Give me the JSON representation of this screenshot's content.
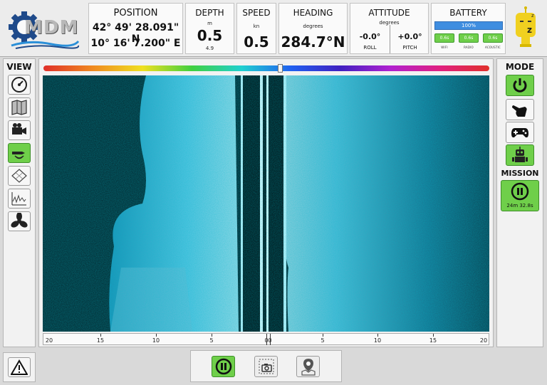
{
  "logo": {
    "text": "MDM"
  },
  "header": {
    "position": {
      "title": "POSITION",
      "lat": "42° 49' 28.091\" N",
      "lon": "10° 16' 7.200\" E"
    },
    "depth": {
      "title": "DEPTH",
      "unit": "m",
      "value": "0.5",
      "sub": "4.9"
    },
    "speed": {
      "title": "SPEED",
      "unit": "kn",
      "value": "0.5"
    },
    "heading": {
      "title": "HEADING",
      "unit": "degrees",
      "value": "284.7°N"
    },
    "attitude": {
      "title": "ATTITUDE",
      "unit": "degrees",
      "roll_value": "-0.0°",
      "roll_label": "ROLL",
      "pitch_value": "+0.0°",
      "pitch_label": "PITCH"
    },
    "battery": {
      "title": "BATTERY",
      "level": "100%",
      "level_fraction": 1.0,
      "links": [
        {
          "value": "0.6s",
          "label": "WIFI"
        },
        {
          "value": "0.6s",
          "label": "RADIO"
        },
        {
          "value": "0.6s",
          "label": "ACOUSTIC"
        }
      ]
    }
  },
  "view": {
    "title": "VIEW",
    "active": "sonar"
  },
  "mode": {
    "title": "MODE"
  },
  "mission": {
    "title": "MISSION",
    "time": "24m 32.8s"
  },
  "colorbar": {
    "handle_fraction": 0.53
  },
  "scale": {
    "left": [
      "20",
      "15",
      "10",
      "5",
      "0"
    ],
    "right": [
      "0",
      "5",
      "10",
      "15",
      "20"
    ]
  },
  "colors": {
    "accent": "#6fcf4a",
    "sonar_bg": "#05242b",
    "sonar_echo": "#4fd0f0"
  }
}
